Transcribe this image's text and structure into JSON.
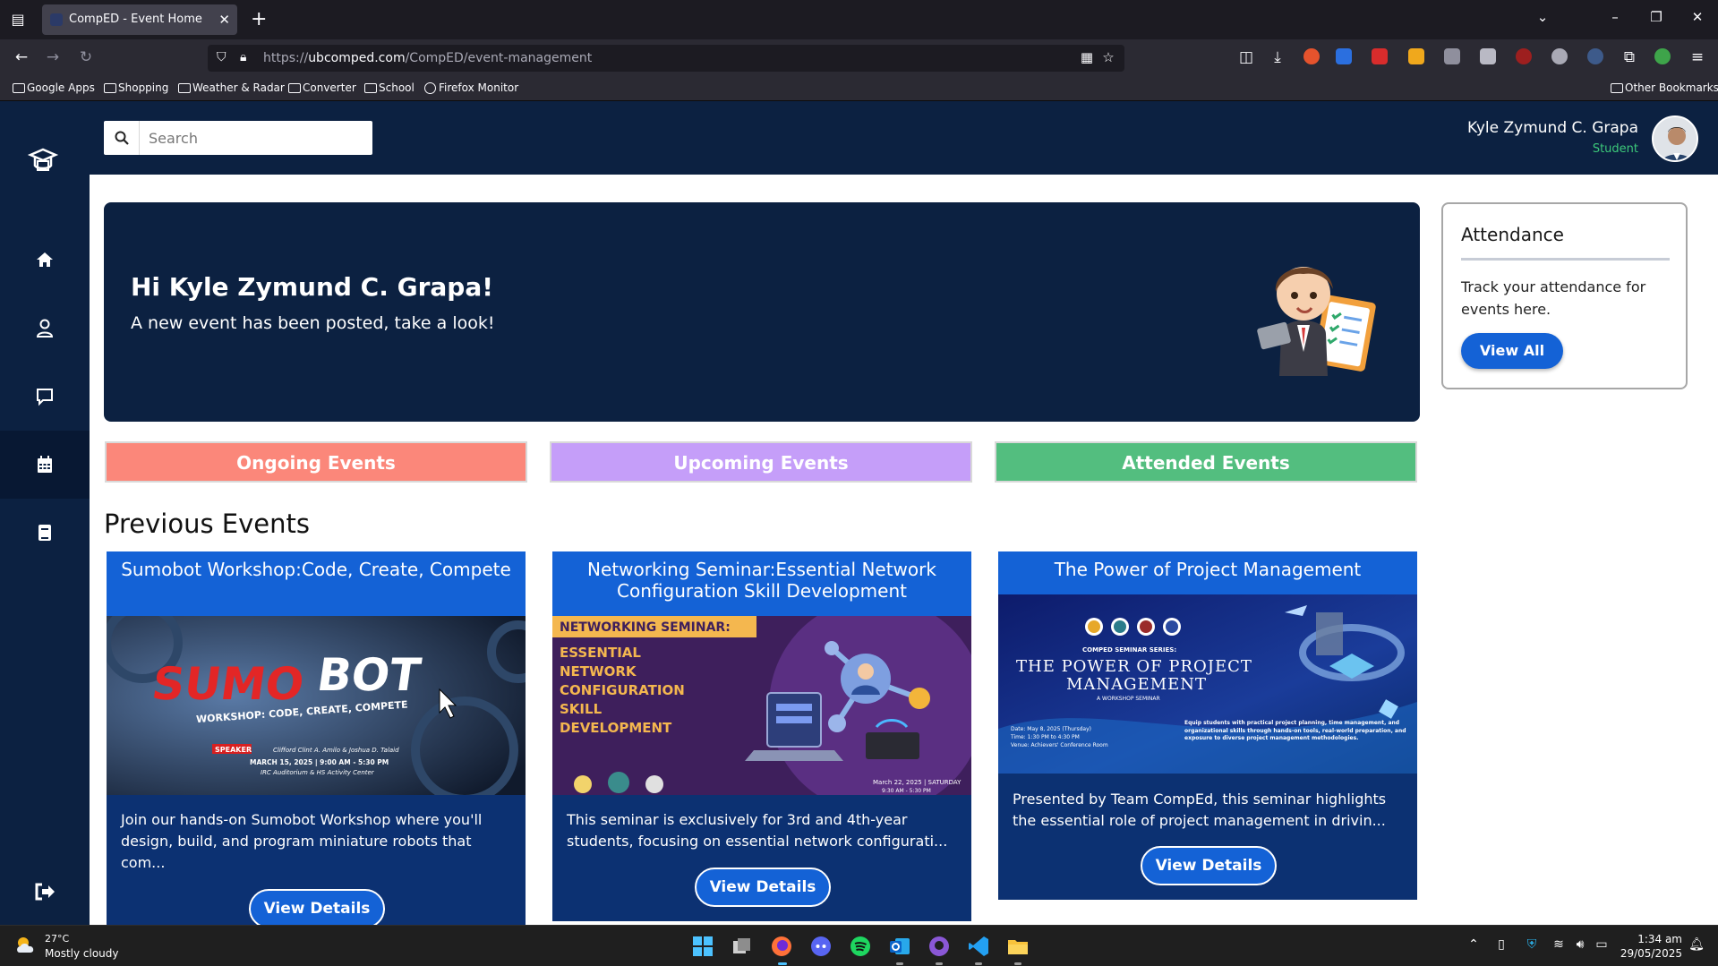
{
  "browser": {
    "tab_title": "CompED - Event Home",
    "url_prefix": "https://",
    "url_host": "ubcomped.com",
    "url_path": "/CompED/event-management",
    "bookmarks": [
      "Google Apps",
      "Shopping",
      "Weather & Radar",
      "Converter",
      "School",
      "Firefox Monitor"
    ],
    "other_bookmarks": "Other Bookmarks"
  },
  "header": {
    "search_placeholder": "Search",
    "user_name": "Kyle Zymund C. Grapa",
    "user_role": "Student"
  },
  "hero": {
    "title": "Hi Kyle Zymund C. Grapa!",
    "subtitle": "A new event has been posted, take a look!"
  },
  "attendance": {
    "title": "Attendance",
    "text": "Track your attendance for events here.",
    "button": "View All"
  },
  "categories": [
    {
      "label": "Ongoing Events",
      "color": "#fb877a"
    },
    {
      "label": "Upcoming Events",
      "color": "#c59ef9"
    },
    {
      "label": "Attended Events",
      "color": "#53be7f"
    }
  ],
  "section_title": "Previous Events",
  "events": [
    {
      "title": "Sumobot Workshop:Code, Create, Compete",
      "description": "Join our hands-on Sumobot Workshop where you'll design, build, and program miniature robots that com...",
      "button": "View Details",
      "poster": {
        "title_a": "SUMO",
        "title_b": "BOT",
        "tagline": "WORKSHOP: CODE, CREATE, COMPETE",
        "badge": "SPEAKER",
        "speakers": "Clifford Clint A. Amilo & Joshua D. Talaid",
        "date": "MARCH 15, 2025 | 9:00 AM - 5:30 PM",
        "venue": "IRC Auditorium & HS Activity Center"
      }
    },
    {
      "title": "Networking Seminar:Essential Network Configuration Skill Development",
      "description": "This seminar is exclusively for 3rd and 4th-year students, focusing on essential network configurati...",
      "button": "View Details",
      "poster": {
        "banner": "NETWORKING SEMINAR:",
        "lines": [
          "ESSENTIAL",
          "NETWORK",
          "CONFIGURATION",
          "SKILL",
          "DEVELOPMENT"
        ],
        "date": "March 22, 2025 | SATURDAY",
        "time": "9:30 AM - 5:30 PM"
      }
    },
    {
      "title": "The Power of Project Management",
      "description": "Presented by Team CompEd, this seminar highlights the essential role of project management in drivin...",
      "button": "View Details",
      "poster": {
        "series": "COMPED SEMINAR SERIES:",
        "line1": "THE POWER OF PROJECT",
        "line2": "MANAGEMENT",
        "kind": "A WORKSHOP SEMINAR",
        "date": "Date: May 8, 2025 (Thursday)",
        "time": "Time: 1:30 PM to 4:30 PM",
        "venue": "Venue: Achievers' Conference Room",
        "blurb": "Equip students with practical project planning, time management, and organizational skills through hands-on tools, real-world preparation, and exposure to diverse project management methodologies."
      }
    }
  ],
  "taskbar": {
    "temp": "27°C",
    "weather": "Mostly cloudy",
    "time": "1:34 am",
    "date": "29/05/2025"
  }
}
